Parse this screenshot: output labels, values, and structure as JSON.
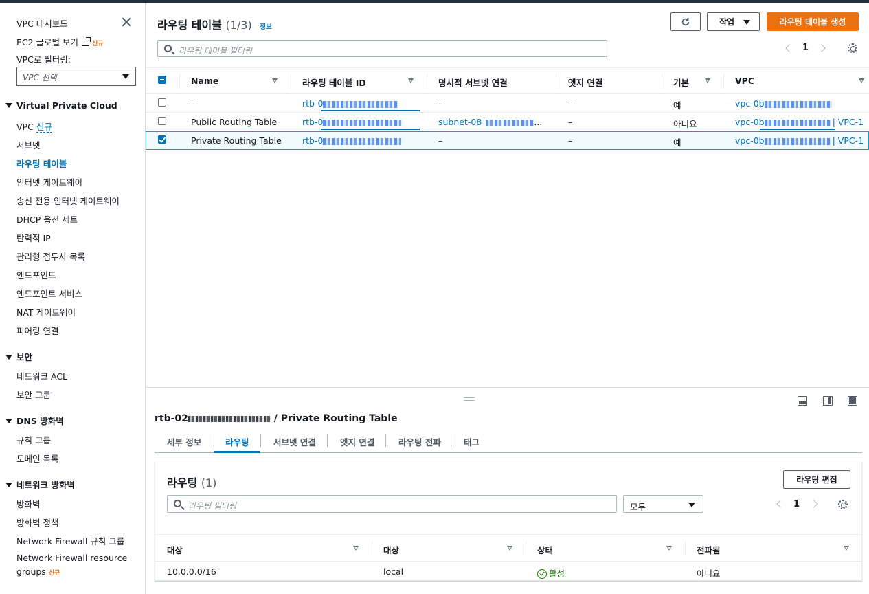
{
  "sidebar": {
    "dashboard": "VPC 대시보드",
    "ec2_global": "EC2 글로벌 보기",
    "new_badge": "신규",
    "filter_label": "VPC로 필터링:",
    "filter_placeholder": "VPC 선택",
    "sections": [
      {
        "title": "Virtual Private Cloud",
        "items": [
          "VPC",
          "서브넷",
          "라우팅 테이블",
          "인터넷 게이트웨이",
          "송신 전용 인터넷 게이트웨이",
          "DHCP 옵션 세트",
          "탄력적 IP",
          "관리형 접두사 목록",
          "엔드포인트",
          "엔드포인트 서비스",
          "NAT 게이트웨이",
          "피어링 연결"
        ]
      },
      {
        "title": "보안",
        "items": [
          "네트워크 ACL",
          "보안 그룹"
        ]
      },
      {
        "title": "DNS 방화벽",
        "items": [
          "규칙 그룹",
          "도메인 목록"
        ]
      },
      {
        "title": "네트워크 방화벽",
        "items": [
          "방화벽",
          "방화벽 정책",
          "Network Firewall 규칙 그룹",
          "Network Firewall resource",
          "groups"
        ]
      }
    ],
    "vpc_new": "신규",
    "active_item": "라우팅 테이블"
  },
  "main": {
    "title": "라우팅 테이블",
    "count": "(1/3)",
    "info": "정보",
    "actions_label": "작업",
    "create_label": "라우팅 테이블 생성",
    "search_placeholder": "라우팅 테이블 필터링",
    "page": "1",
    "columns": [
      "Name",
      "라우팅 테이블 ID",
      "명시적 서브넷 연결",
      "엣지 연결",
      "기본",
      "VPC"
    ],
    "rows": [
      {
        "name": "–",
        "rtb": "rtb-0",
        "subnet": "–",
        "edge": "–",
        "main": "예",
        "vpc": "vpc-0b",
        "vpc_name": "",
        "selected": false
      },
      {
        "name": "Public Routing Table",
        "rtb": "rtb-0",
        "subnet": "subnet-08",
        "subnet_suffix": "...",
        "edge": "–",
        "main": "아니요",
        "vpc": "vpc-0b",
        "vpc_name": "| VPC-1",
        "selected": false
      },
      {
        "name": "Private Routing Table",
        "rtb": "rtb-0",
        "subnet": "–",
        "edge": "–",
        "main": "예",
        "vpc": "vpc-0b",
        "vpc_name": "| VPC-1",
        "selected": true
      }
    ]
  },
  "detail": {
    "title_prefix": "rtb-02",
    "title_suffix": "/ Private Routing Table",
    "tabs": [
      "세부 정보",
      "라우팅",
      "서브넷 연결",
      "엣지 연결",
      "라우팅 전파",
      "태그"
    ],
    "active_tab": "라우팅",
    "routes": {
      "title": "라우팅",
      "count": "(1)",
      "edit_label": "라우팅 편집",
      "search_placeholder": "라우팅 필터링",
      "select_value": "모두",
      "page": "1",
      "columns": [
        "대상",
        "대상",
        "상태",
        "전파됨"
      ],
      "rows": [
        {
          "destination": "10.0.0.0/16",
          "target": "local",
          "status": "활성",
          "propagated": "아니요"
        }
      ]
    }
  },
  "colors": {
    "accent": "#0073bb",
    "primary_button": "#ec7211",
    "status_ok": "#1d8102",
    "new_badge": "#ec7211"
  }
}
